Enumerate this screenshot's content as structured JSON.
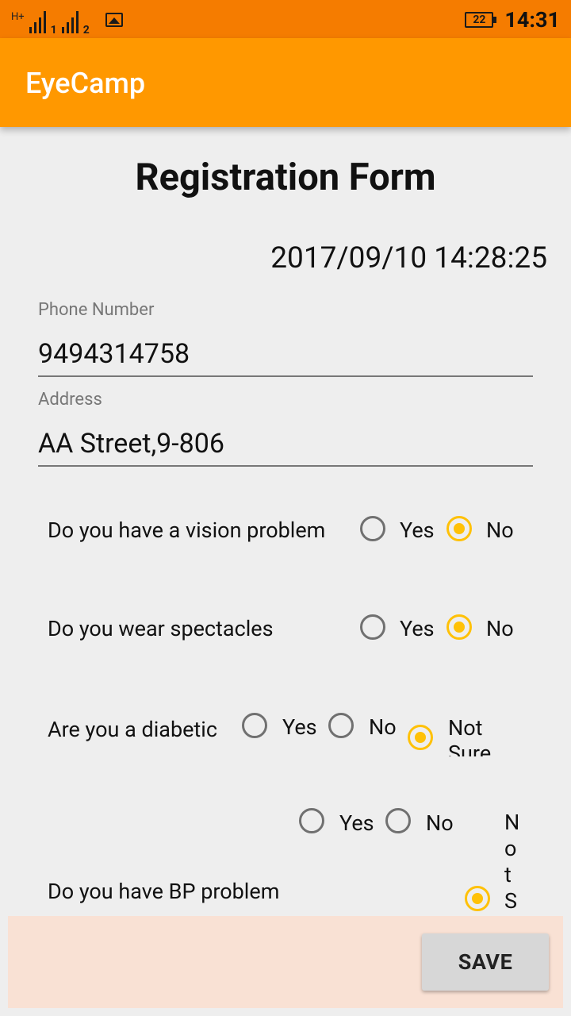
{
  "status_bar": {
    "network_type": "H+",
    "sim1": "1",
    "sim2": "2",
    "battery": "22",
    "time": "14:31",
    "icons": [
      "signal-icon",
      "gallery-notification-icon",
      "battery-icon"
    ]
  },
  "app_bar": {
    "title": "EyeCamp",
    "color": "#ff9800"
  },
  "form": {
    "title": "Registration Form",
    "datetime": "2017/09/10 14:28:25",
    "phone": {
      "label": "Phone Number",
      "value": "9494314758"
    },
    "address": {
      "label": "Address",
      "value": "AA Street,9-806"
    },
    "questions": [
      {
        "text": "Do you have a vision problem",
        "options": [
          "Yes",
          "No"
        ],
        "selected": "No"
      },
      {
        "text": "Do you wear spectacles",
        "options": [
          "Yes",
          "No"
        ],
        "selected": "No"
      },
      {
        "text": "Are you a diabetic",
        "options": [
          "Yes",
          "No",
          "Not Sure"
        ],
        "selected": "Not Sure"
      },
      {
        "text": "Do you have BP problem",
        "options": [
          "Yes",
          "No",
          "Not Sure"
        ],
        "selected": "Not Sure"
      }
    ]
  },
  "actions": {
    "save_label": "SAVE"
  },
  "colors": {
    "accent": "#ffc107",
    "status_bar": "#f57c00",
    "bottom_panel": "#f9e1d4"
  }
}
